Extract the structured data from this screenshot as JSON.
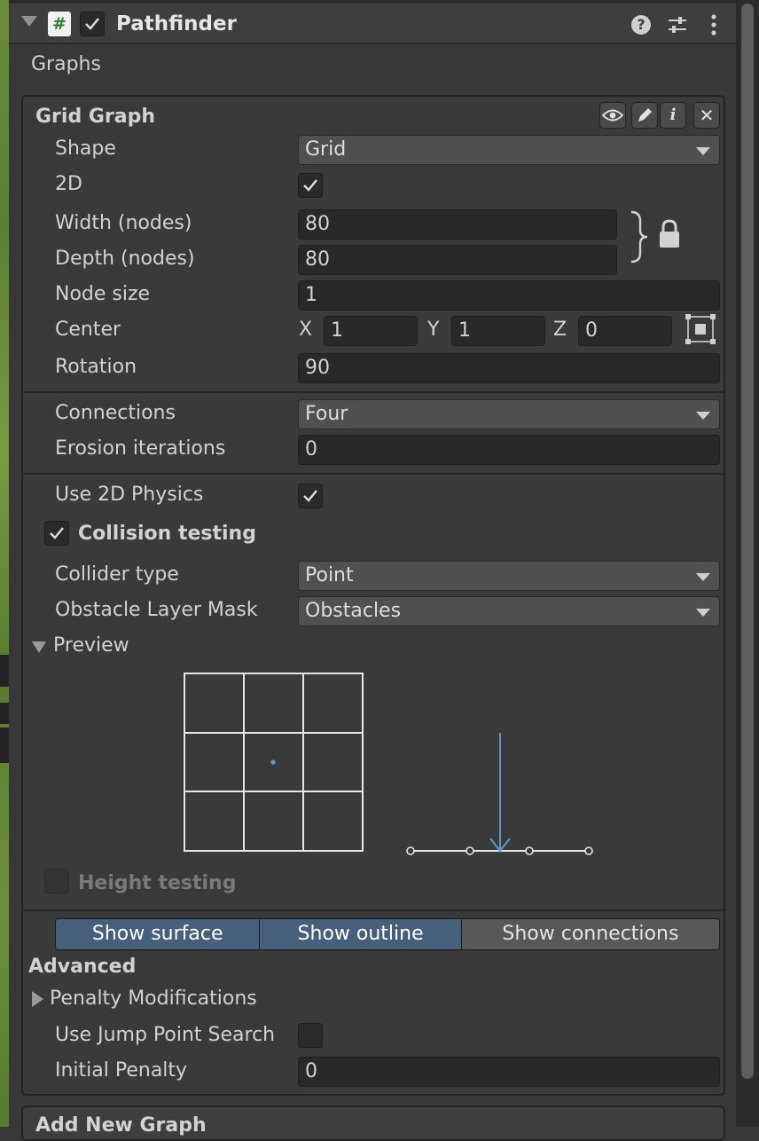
{
  "component": {
    "title": "Pathfinder",
    "script_icon": "#",
    "enabled": true,
    "icons": {
      "fold": "chevron-down-icon",
      "help": "?",
      "help_icon": "help-icon",
      "preset_icon": "sliders-icon",
      "more_icon": "more-vertical-icon"
    }
  },
  "graphs_label": "Graphs",
  "grid_graph": {
    "title": "Grid Graph",
    "toolbar": {
      "eye_icon": "eye-icon",
      "pencil_icon": "pencil-icon",
      "info": "i",
      "close": "✕"
    },
    "shape": {
      "label": "Shape",
      "value": "Grid"
    },
    "two_d": {
      "label": "2D",
      "checked": true
    },
    "width": {
      "label": "Width (nodes)",
      "value": "80"
    },
    "depth": {
      "label": "Depth (nodes)",
      "value": "80"
    },
    "node_size": {
      "label": "Node size",
      "value": "1"
    },
    "center": {
      "label": "Center",
      "x_label": "X",
      "x": "1",
      "y_label": "Y",
      "y": "1",
      "z_label": "Z",
      "z": "0"
    },
    "rotation": {
      "label": "Rotation",
      "value": "90"
    },
    "connections": {
      "label": "Connections",
      "value": "Four"
    },
    "erosion": {
      "label": "Erosion iterations",
      "value": "0"
    },
    "use_2d_physics": {
      "label": "Use 2D Physics",
      "checked": true
    },
    "collision_testing": {
      "label": "Collision testing",
      "checked": true
    },
    "collider_type": {
      "label": "Collider type",
      "value": "Point"
    },
    "obstacle_mask": {
      "label": "Obstacle Layer Mask",
      "value": "Obstacles"
    },
    "preview": {
      "label": "Preview",
      "expanded": true
    },
    "height_testing": {
      "label": "Height testing",
      "checked": false
    },
    "view_toggles": [
      {
        "label": "Show surface",
        "active": true
      },
      {
        "label": "Show outline",
        "active": true
      },
      {
        "label": "Show connections",
        "active": false
      }
    ],
    "advanced": {
      "label": "Advanced",
      "penalty_modifications": "Penalty Modifications",
      "jump_point_search": {
        "label": "Use Jump Point Search",
        "checked": false
      },
      "initial_penalty": {
        "label": "Initial Penalty",
        "value": "0"
      }
    }
  },
  "add_new_graph": "Add New Graph",
  "colors": {
    "accent": "#46607c",
    "preview_blue": "#5b9bd5",
    "panel": "#383838"
  }
}
